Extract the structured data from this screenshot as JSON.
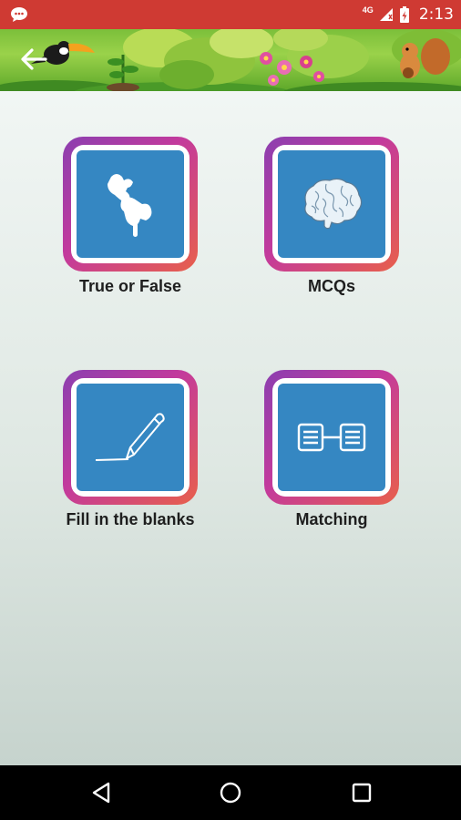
{
  "status_bar": {
    "network": "4G",
    "time": "2:13",
    "icons": [
      "chat-notification-icon",
      "signal-icon",
      "battery-charging-icon"
    ]
  },
  "header": {
    "back_icon": "back-arrow-icon"
  },
  "tiles": [
    {
      "label": "True or False",
      "icon": "puzzle-hands-icon"
    },
    {
      "label": "MCQs",
      "icon": "brain-icon"
    },
    {
      "label": "Fill in the blanks",
      "icon": "pencil-line-icon"
    },
    {
      "label": "Matching",
      "icon": "matching-link-icon"
    }
  ],
  "nav_bar": {
    "icons": [
      "back-triangle-icon",
      "home-circle-icon",
      "recents-square-icon"
    ]
  },
  "colors": {
    "status_bar": "#cf3a33",
    "tile_blue": "#3587c2",
    "tile_gradient_start": "#8b3fb0",
    "tile_gradient_end": "#e8604b"
  }
}
